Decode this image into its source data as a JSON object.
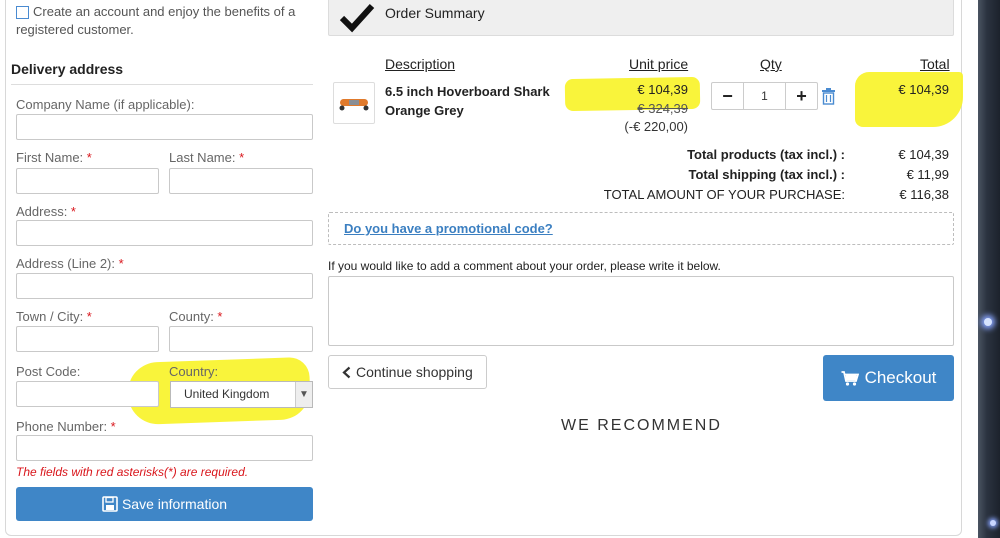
{
  "account": {
    "create_label": "Create an account and enjoy the benefits of a registered customer."
  },
  "delivery": {
    "title": "Delivery address",
    "company_label": "Company Name (if applicable):",
    "first_name_label": "First Name: ",
    "last_name_label": "Last Name: ",
    "address_label": "Address: ",
    "address2_label": "Address (Line 2): ",
    "town_label": "Town / City: ",
    "county_label": "County: ",
    "postcode_label": "Post Code:",
    "country_label": "Country:",
    "country_value": "United Kingdom",
    "phone_label": "Phone Number: ",
    "asterisk": "*",
    "required_note": "The fields with red asterisks(*) are required.",
    "save_label": "Save information"
  },
  "summary": {
    "title": "Order Summary",
    "headers": {
      "description": "Description",
      "unit_price": "Unit price",
      "qty": "Qty",
      "total": "Total"
    },
    "item": {
      "name": "6.5 inch Hoverboard Shark Orange Grey",
      "price": "€ 104,39",
      "old_price": "€ 324,39",
      "discount": "(-€ 220,00)",
      "quantity": "1",
      "line_total": "€ 104,39",
      "minus": "−",
      "plus": "+"
    },
    "totals": [
      {
        "label": "Total products  (tax incl.) :",
        "value": "€ 104,39"
      },
      {
        "label": "Total shipping  (tax incl.) :",
        "value": "€ 11,99"
      },
      {
        "label": "TOTAL AMOUNT OF YOUR PURCHASE:",
        "value": "€ 116,38"
      }
    ],
    "promo_link": "Do you have a promotional code?",
    "comment_label": "If you would like to add a comment about your order, please write it below.",
    "continue_label": "Continue shopping",
    "checkout_label": "Checkout",
    "recommend_title": "WE RECOMMEND"
  },
  "colors": {
    "primary": "#3f86c7",
    "highlight": "#f8f32a",
    "required": "#d9161c"
  }
}
